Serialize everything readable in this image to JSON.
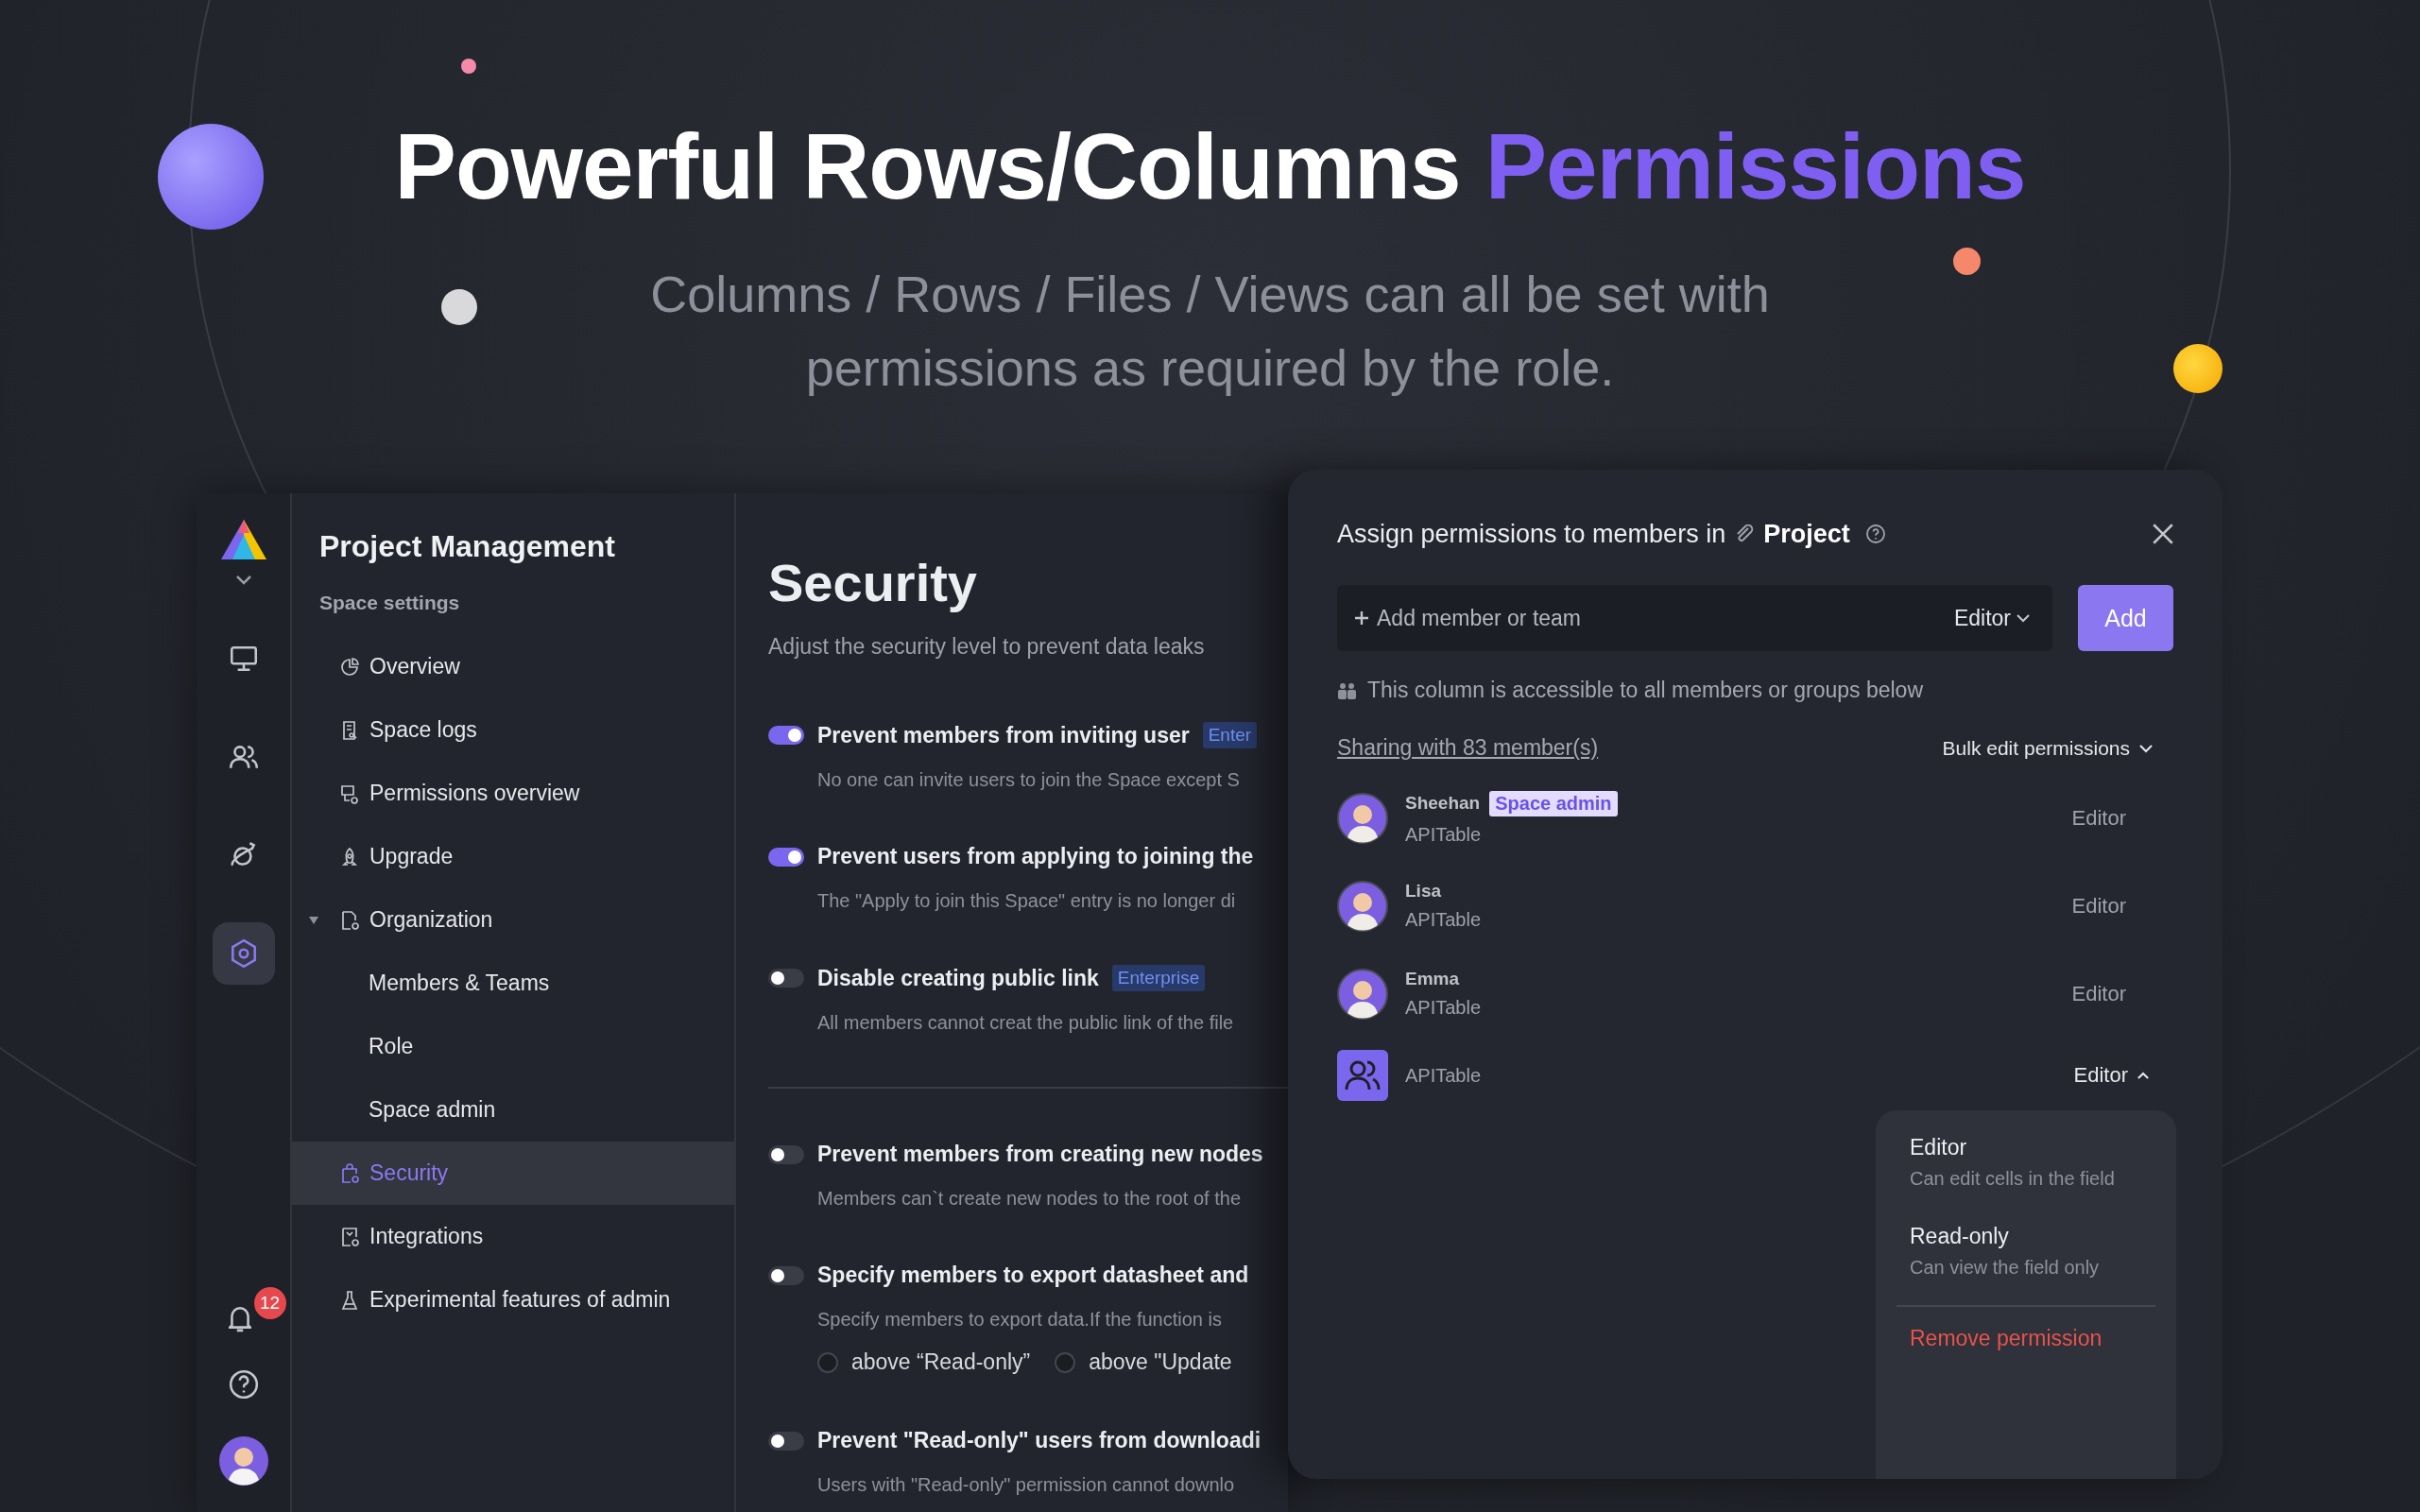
{
  "hero": {
    "title": "Powerful Rows/Columns",
    "title_highlight": "Permissions",
    "subtitle": "Columns / Rows / Files / Views can all be set with permissions as required by the role."
  },
  "rail": {
    "top": [
      {
        "kind": "logo"
      },
      {
        "kind": "chevron"
      },
      {
        "kind": "monitor",
        "selected": false
      },
      {
        "kind": "people",
        "selected": false
      },
      {
        "kind": "planet",
        "selected": false
      },
      {
        "kind": "settings",
        "selected": true
      }
    ],
    "bottom": [
      {
        "kind": "bell",
        "badge": "12"
      },
      {
        "kind": "help"
      },
      {
        "kind": "avatar"
      }
    ]
  },
  "sidebar": {
    "title": "Project Management",
    "section": "Space settings",
    "items": [
      {
        "label": "Overview",
        "kind": "pie",
        "selected": false
      },
      {
        "label": "Space logs",
        "kind": "log",
        "selected": false
      },
      {
        "label": "Permissions overview",
        "kind": "permissions",
        "selected": false
      },
      {
        "label": "Upgrade",
        "kind": "rocket",
        "selected": false
      },
      {
        "label": "Organization",
        "kind": "folder",
        "selected": false,
        "expanded": true,
        "children": [
          {
            "label": "Members & Teams",
            "selected": false
          },
          {
            "label": "Role",
            "selected": false
          },
          {
            "label": "Space admin",
            "selected": false
          }
        ]
      },
      {
        "label": "Security",
        "kind": "lock",
        "selected": true
      },
      {
        "label": "Integrations",
        "kind": "integration",
        "selected": false
      },
      {
        "label": "Experimental features of admin",
        "kind": "flask",
        "selected": false
      }
    ]
  },
  "security": {
    "title": "Security",
    "subtitle": "Adjust the security level to prevent data leaks",
    "groups": [
      [
        {
          "label": "Prevent members from inviting user",
          "badge": "Enter",
          "on": true,
          "description": "No one can invite users to join the Space except S"
        },
        {
          "label": "Prevent users from applying to joining the",
          "on": true,
          "description": "The \"Apply to join this Space\" entry is no longer di"
        },
        {
          "label": "Disable creating public link",
          "badge": "Enterprise",
          "on": false,
          "description": "All members cannot creat the public link of the file"
        }
      ],
      [
        {
          "label": "Prevent members from creating new nodes",
          "on": false,
          "description": "Members can`t create new nodes to the root of the"
        },
        {
          "label": "Specify members to export datasheet and",
          "on": false,
          "description": "Specify members to export data.If the function is",
          "options": [
            {
              "label": "above “Read-only”",
              "selected": false
            },
            {
              "label": "above \"Update",
              "selected": false
            }
          ]
        },
        {
          "label": "Prevent \"Read-only\" users from downloadi",
          "on": false,
          "description": "Users with \"Read-only\" permission cannot downlo"
        }
      ]
    ]
  },
  "dialog": {
    "title": "Assign permissions to members in",
    "project": "Project",
    "placeholder": "Add member or team",
    "role": "Editor",
    "add_button": "Add",
    "info": "This column is accessible to all members or groups below",
    "sharing_link": "Sharing with 83 member(s)",
    "bulk_edit": "Bulk edit permissions",
    "members": [
      {
        "kind": "person",
        "name": "Sheehan",
        "badge": "Space admin",
        "team": "APITable",
        "role": "Editor",
        "expanded": false
      },
      {
        "kind": "person",
        "name": "Lisa",
        "team": "APITable",
        "role": "Editor",
        "expanded": false
      },
      {
        "kind": "person",
        "name": "Emma",
        "team": "APITable",
        "role": "Editor",
        "expanded": false
      },
      {
        "kind": "team",
        "team": "APITable",
        "role": "Editor",
        "expanded": true
      }
    ],
    "menu": [
      {
        "kind": "option",
        "label": "Editor",
        "description": "Can edit cells in the field"
      },
      {
        "kind": "option",
        "label": "Read-only",
        "description": "Can view the field only"
      },
      {
        "kind": "danger",
        "label": "Remove permission"
      }
    ]
  }
}
